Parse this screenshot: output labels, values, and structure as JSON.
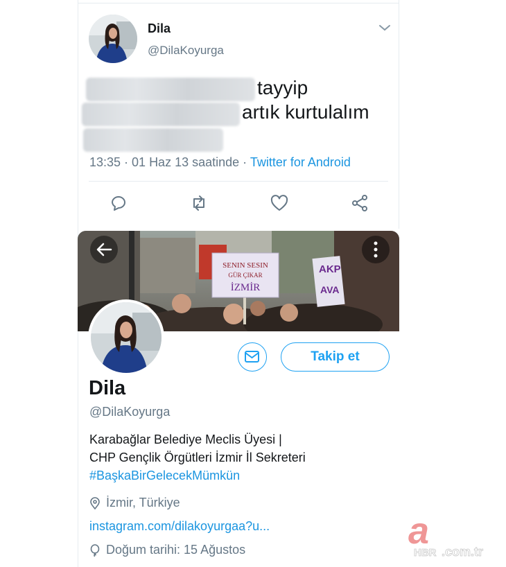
{
  "tweet": {
    "author_name": "Dila",
    "author_handle": "@DilaKoyurga",
    "text_line1": "tayyip",
    "text_line2": "artık kurtulalım",
    "time": "13:35 · 01 Haz 13 saatinde · ",
    "source": "Twitter for Android",
    "actions": [
      "reply-icon",
      "retweet-icon",
      "like-icon",
      "share-icon"
    ]
  },
  "profile": {
    "banner_sign_line1": "SENIN SESIN",
    "banner_sign_line2": "GÜR ÇIKAR",
    "banner_sign_line3": "İZMİR",
    "banner_sign_right": "AKP",
    "banner_sign_right2": "AVA",
    "follow_label": "Takip et",
    "name": "Dila",
    "handle": "@DilaKoyurga",
    "bio_line1": "Karabağlar Belediye Meclis Üyesi |",
    "bio_line2": "CHP Gençlik Örgütleri İzmir İl Sekreteri",
    "bio_hashtag": "#BaşkaBirGelecekMümkün",
    "location": "İzmir, Türkiye",
    "website": "instagram.com/dilakoyurgaa?u...",
    "birthday": "Doğum tarihi: 15 Ağustos"
  },
  "watermark": {
    "brand_letter": "a",
    "brand_text": "HBR",
    "domain": ".com.tr"
  },
  "colors": {
    "accent": "#1da1f2",
    "link": "#1b95e0",
    "muted": "#657786"
  }
}
